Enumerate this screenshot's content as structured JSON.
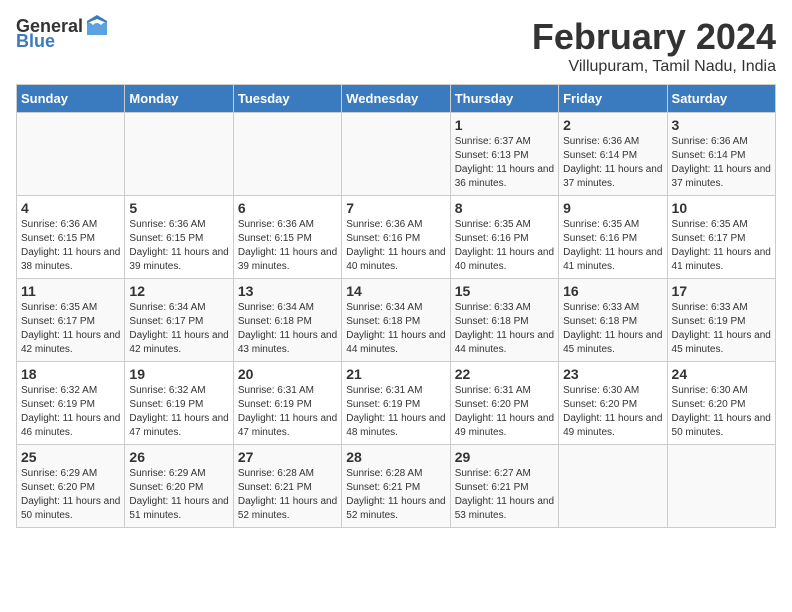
{
  "logo": {
    "general": "General",
    "blue": "Blue"
  },
  "header": {
    "title": "February 2024",
    "subtitle": "Villupuram, Tamil Nadu, India"
  },
  "weekdays": [
    "Sunday",
    "Monday",
    "Tuesday",
    "Wednesday",
    "Thursday",
    "Friday",
    "Saturday"
  ],
  "weeks": [
    [
      {
        "day": "",
        "info": ""
      },
      {
        "day": "",
        "info": ""
      },
      {
        "day": "",
        "info": ""
      },
      {
        "day": "",
        "info": ""
      },
      {
        "day": "1",
        "info": "Sunrise: 6:37 AM\nSunset: 6:13 PM\nDaylight: 11 hours and 36 minutes."
      },
      {
        "day": "2",
        "info": "Sunrise: 6:36 AM\nSunset: 6:14 PM\nDaylight: 11 hours and 37 minutes."
      },
      {
        "day": "3",
        "info": "Sunrise: 6:36 AM\nSunset: 6:14 PM\nDaylight: 11 hours and 37 minutes."
      }
    ],
    [
      {
        "day": "4",
        "info": "Sunrise: 6:36 AM\nSunset: 6:15 PM\nDaylight: 11 hours and 38 minutes."
      },
      {
        "day": "5",
        "info": "Sunrise: 6:36 AM\nSunset: 6:15 PM\nDaylight: 11 hours and 39 minutes."
      },
      {
        "day": "6",
        "info": "Sunrise: 6:36 AM\nSunset: 6:15 PM\nDaylight: 11 hours and 39 minutes."
      },
      {
        "day": "7",
        "info": "Sunrise: 6:36 AM\nSunset: 6:16 PM\nDaylight: 11 hours and 40 minutes."
      },
      {
        "day": "8",
        "info": "Sunrise: 6:35 AM\nSunset: 6:16 PM\nDaylight: 11 hours and 40 minutes."
      },
      {
        "day": "9",
        "info": "Sunrise: 6:35 AM\nSunset: 6:16 PM\nDaylight: 11 hours and 41 minutes."
      },
      {
        "day": "10",
        "info": "Sunrise: 6:35 AM\nSunset: 6:17 PM\nDaylight: 11 hours and 41 minutes."
      }
    ],
    [
      {
        "day": "11",
        "info": "Sunrise: 6:35 AM\nSunset: 6:17 PM\nDaylight: 11 hours and 42 minutes."
      },
      {
        "day": "12",
        "info": "Sunrise: 6:34 AM\nSunset: 6:17 PM\nDaylight: 11 hours and 42 minutes."
      },
      {
        "day": "13",
        "info": "Sunrise: 6:34 AM\nSunset: 6:18 PM\nDaylight: 11 hours and 43 minutes."
      },
      {
        "day": "14",
        "info": "Sunrise: 6:34 AM\nSunset: 6:18 PM\nDaylight: 11 hours and 44 minutes."
      },
      {
        "day": "15",
        "info": "Sunrise: 6:33 AM\nSunset: 6:18 PM\nDaylight: 11 hours and 44 minutes."
      },
      {
        "day": "16",
        "info": "Sunrise: 6:33 AM\nSunset: 6:18 PM\nDaylight: 11 hours and 45 minutes."
      },
      {
        "day": "17",
        "info": "Sunrise: 6:33 AM\nSunset: 6:19 PM\nDaylight: 11 hours and 45 minutes."
      }
    ],
    [
      {
        "day": "18",
        "info": "Sunrise: 6:32 AM\nSunset: 6:19 PM\nDaylight: 11 hours and 46 minutes."
      },
      {
        "day": "19",
        "info": "Sunrise: 6:32 AM\nSunset: 6:19 PM\nDaylight: 11 hours and 47 minutes."
      },
      {
        "day": "20",
        "info": "Sunrise: 6:31 AM\nSunset: 6:19 PM\nDaylight: 11 hours and 47 minutes."
      },
      {
        "day": "21",
        "info": "Sunrise: 6:31 AM\nSunset: 6:19 PM\nDaylight: 11 hours and 48 minutes."
      },
      {
        "day": "22",
        "info": "Sunrise: 6:31 AM\nSunset: 6:20 PM\nDaylight: 11 hours and 49 minutes."
      },
      {
        "day": "23",
        "info": "Sunrise: 6:30 AM\nSunset: 6:20 PM\nDaylight: 11 hours and 49 minutes."
      },
      {
        "day": "24",
        "info": "Sunrise: 6:30 AM\nSunset: 6:20 PM\nDaylight: 11 hours and 50 minutes."
      }
    ],
    [
      {
        "day": "25",
        "info": "Sunrise: 6:29 AM\nSunset: 6:20 PM\nDaylight: 11 hours and 50 minutes."
      },
      {
        "day": "26",
        "info": "Sunrise: 6:29 AM\nSunset: 6:20 PM\nDaylight: 11 hours and 51 minutes."
      },
      {
        "day": "27",
        "info": "Sunrise: 6:28 AM\nSunset: 6:21 PM\nDaylight: 11 hours and 52 minutes."
      },
      {
        "day": "28",
        "info": "Sunrise: 6:28 AM\nSunset: 6:21 PM\nDaylight: 11 hours and 52 minutes."
      },
      {
        "day": "29",
        "info": "Sunrise: 6:27 AM\nSunset: 6:21 PM\nDaylight: 11 hours and 53 minutes."
      },
      {
        "day": "",
        "info": ""
      },
      {
        "day": "",
        "info": ""
      }
    ]
  ]
}
